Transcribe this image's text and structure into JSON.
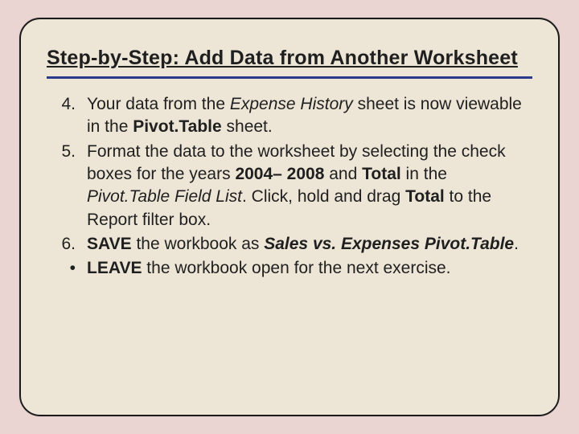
{
  "title": "Step-by-Step: Add Data from Another Worksheet",
  "items": [
    {
      "marker": "4.",
      "segments": [
        {
          "t": "Your data from the ",
          "c": ""
        },
        {
          "t": "Expense History",
          "c": "italic"
        },
        {
          "t": " sheet is now viewable in the ",
          "c": ""
        },
        {
          "t": "Pivot.Table",
          "c": "bold"
        },
        {
          "t": " sheet.",
          "c": ""
        }
      ]
    },
    {
      "marker": "5.",
      "segments": [
        {
          "t": "Format the data to the worksheet by selecting the check boxes for the years ",
          "c": ""
        },
        {
          "t": "2004– 2008",
          "c": "bold"
        },
        {
          "t": " and ",
          "c": ""
        },
        {
          "t": "Total",
          "c": "bold"
        },
        {
          "t": " in the ",
          "c": ""
        },
        {
          "t": "Pivot.Table Field List",
          "c": "italic"
        },
        {
          "t": ". Click, hold and drag ",
          "c": ""
        },
        {
          "t": "Total",
          "c": "bold"
        },
        {
          "t": " to the Report filter box.",
          "c": ""
        }
      ]
    },
    {
      "marker": "6.",
      "segments": [
        {
          "t": "SAVE",
          "c": "bold"
        },
        {
          "t": " the workbook as ",
          "c": ""
        },
        {
          "t": "Sales vs. Expenses Pivot.Table",
          "c": "bolditalic"
        },
        {
          "t": ".",
          "c": ""
        }
      ]
    },
    {
      "marker": "•",
      "segments": [
        {
          "t": "LEAVE",
          "c": "bold"
        },
        {
          "t": " the workbook open for the next exercise.",
          "c": ""
        }
      ]
    }
  ]
}
